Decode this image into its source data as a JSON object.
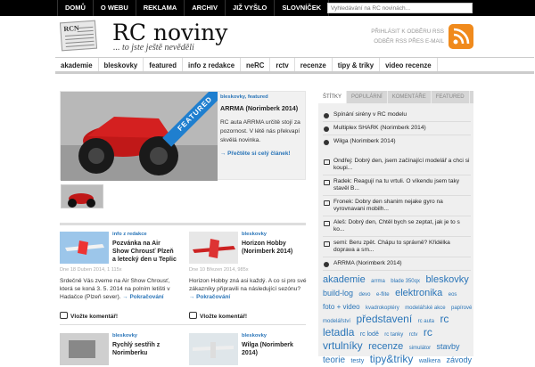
{
  "topnav": {
    "items": [
      "DOMŮ",
      "O WEBU",
      "REKLAMA",
      "ARCHIV",
      "JIŽ VYŠLO",
      "SLOVNÍČEK"
    ]
  },
  "search": {
    "placeholder": "Vyhledávání na RC novinách..."
  },
  "logo": {
    "icon_text": "RCN",
    "title": "RC noviny",
    "tagline": "... to jste ještě nevěděli"
  },
  "rss": {
    "email_link": "PŘIHLÁSIT K ODBĚRU RSS",
    "email_link2": "ODBĚR RSS PŘES E-MAIL"
  },
  "catnav": {
    "items": [
      "akademie",
      "bleskovky",
      "featured",
      "info z redakce",
      "neRC",
      "rctv",
      "recenze",
      "tipy & triky",
      "video recenze"
    ]
  },
  "featured": {
    "ribbon": "FEATURED",
    "meta": "bleskovky, featured",
    "title": "ARRMA (Norimberk 2014)",
    "excerpt": "RC auta ARRMA určitě stojí za pozornost. V létě nás překvapí skvělá novinka.",
    "more": "→ Přečtěte si celý článek!"
  },
  "posts": [
    {
      "meta": "info z redakce",
      "title": "Pozvánka na Air Show Chrousť Plzeň a letecký den u Teplic",
      "date": "Dne 18 Duben 2014, 1 115x",
      "excerpt": "Srdečně Vás zveme na Air Show Chrousť, která se koná 3. 5. 2014 na polním letišti v Hadačce (Plzeň sever).",
      "more": "→ Pokračování",
      "comments": "Vložte komentář!"
    },
    {
      "meta": "bleskovky",
      "title": "Horizon Hobby (Norimberk 2014)",
      "date": "Dne 10 Březen 2014, 985x",
      "excerpt": "Horizon Hobby zná asi každý. A co si pro své zákazníky připravili na následující sezónu?",
      "more": "→ Pokračování",
      "comments": "Vložte komentář!"
    },
    {
      "meta": "bleskovky",
      "title": "Rychlý sestřih z Norimberku",
      "date": "",
      "excerpt": "",
      "more": "",
      "comments": ""
    },
    {
      "meta": "bleskovky",
      "title": "Wilga (Norimberk 2014)",
      "date": "",
      "excerpt": "",
      "more": "",
      "comments": ""
    }
  ],
  "sidebar": {
    "tabs": [
      "ŠTÍTKY",
      "POPULÁRNÍ",
      "KOMENTÁŘE",
      "FEATURED"
    ],
    "popular": [
      "Spínání sirény v RC modelu",
      "Multiplex SHARK (Norimberk 2014)",
      "Wilga (Norimberk 2014)"
    ],
    "comments": [
      "Ondřej: Dobrý den, jsem začínající modelář a chci si koupi...",
      "Radek: Reagují na tu vrtuli. O víkendu jsem taky stavěl B...",
      "Fronek: Dobry den shanim nejake gyro na vyrovnavani mobilh...",
      "Aleš: Dobrý den, Chtěl bych se zeptat, jak je to s ko...",
      "semi: Beru zpět. Chápu to správně? Křidélka doprava a sm..."
    ],
    "featured": [
      "ARRMA (Norimberk 2014)"
    ],
    "tags": [
      {
        "t": "akademie",
        "s": 11
      },
      {
        "t": "arrma",
        "s": 6
      },
      {
        "t": "blade 350qx",
        "s": 6
      },
      {
        "t": "bleskovky",
        "s": 11
      },
      {
        "t": "build-log",
        "s": 9
      },
      {
        "t": "devo",
        "s": 6
      },
      {
        "t": "e-flite",
        "s": 6
      },
      {
        "t": "elektronika",
        "s": 11
      },
      {
        "t": "eos",
        "s": 6
      },
      {
        "t": "foto + video",
        "s": 8
      },
      {
        "t": "kvadrokoptéry",
        "s": 6
      },
      {
        "t": "modelářské akce",
        "s": 6
      },
      {
        "t": "papírové modelářství",
        "s": 6
      },
      {
        "t": "představení",
        "s": 12
      },
      {
        "t": "rc auta",
        "s": 6
      },
      {
        "t": "rc letadla",
        "s": 12
      },
      {
        "t": "rc lodě",
        "s": 7
      },
      {
        "t": "rc tanky",
        "s": 6
      },
      {
        "t": "rctv",
        "s": 6
      },
      {
        "t": "rc vrtulníky",
        "s": 12
      },
      {
        "t": "recenze",
        "s": 11
      },
      {
        "t": "simulátor",
        "s": 6
      },
      {
        "t": "stavby",
        "s": 9
      },
      {
        "t": "teorie",
        "s": 10
      },
      {
        "t": "testy",
        "s": 7
      },
      {
        "t": "tipy&triky",
        "s": 12
      },
      {
        "t": "walkera",
        "s": 7
      },
      {
        "t": "závody",
        "s": 9
      }
    ]
  }
}
